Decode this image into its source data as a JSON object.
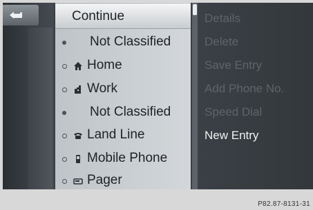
{
  "list": {
    "items": [
      {
        "label": "Continue",
        "bullet": "none",
        "icon": "none",
        "selected": true
      },
      {
        "label": "Not Classified",
        "bullet": "dot",
        "icon": "none",
        "selected": false
      },
      {
        "label": "Home",
        "bullet": "ring",
        "icon": "home-icon",
        "selected": false
      },
      {
        "label": "Work",
        "bullet": "ring",
        "icon": "work-icon",
        "selected": false
      },
      {
        "label": "Not Classified",
        "bullet": "dot",
        "icon": "none",
        "selected": false
      },
      {
        "label": "Land Line",
        "bullet": "ring",
        "icon": "landline-phone-icon",
        "selected": false
      },
      {
        "label": "Mobile Phone",
        "bullet": "ring",
        "icon": "mobile-phone-icon",
        "selected": false
      },
      {
        "label": "Pager",
        "bullet": "ring",
        "icon": "pager-icon",
        "selected": false
      }
    ]
  },
  "options": {
    "items": [
      {
        "label": "Details",
        "enabled": false
      },
      {
        "label": "Delete",
        "enabled": false
      },
      {
        "label": "Save Entry",
        "enabled": false
      },
      {
        "label": "Add Phone No.",
        "enabled": false
      },
      {
        "label": "Speed Dial",
        "enabled": false
      },
      {
        "label": "New Entry",
        "enabled": true
      }
    ]
  },
  "caption": "P82.87-8131-31",
  "colors": {
    "highlight": "#f2f3f4",
    "text_active": "#f1f3f4",
    "text_disabled": "#5e6468"
  }
}
